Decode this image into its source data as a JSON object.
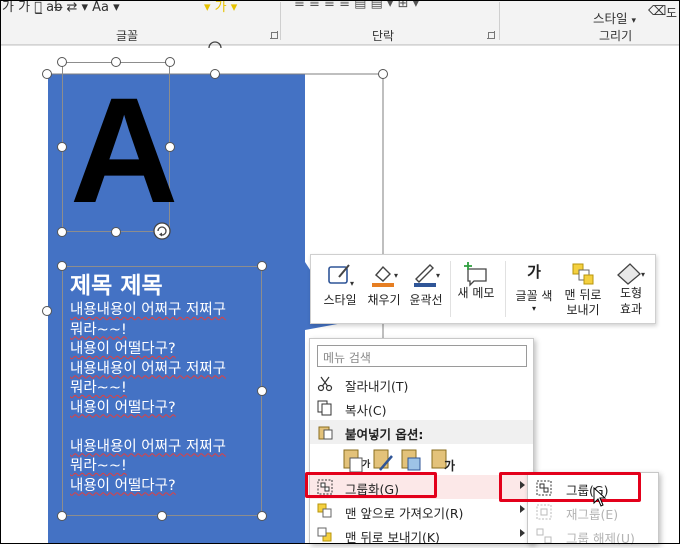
{
  "ribbon": {
    "font_tools": "가 가 가̲ ab̶ ⇄ ▾ Aa ▾",
    "color_tools": "▾  가 ▾",
    "paragraph_tools": "≡ ≡ ≡ ≡ ▤   ▤ ▾  ⊞ ▾",
    "style_label": "스타일",
    "style_arrow": "▾",
    "group_font": "글꼴",
    "group_paragraph": "단락",
    "group_drawing": "그리기",
    "cut_off_char": "도"
  },
  "slide": {
    "big_letter": "A",
    "title": "제목 제목",
    "body_lines": [
      "내용내용이 어쩌구 저쩌구",
      "뭐라~~!",
      "내용이 어떨다구?",
      "내용내용이 어쩌구 저쩌구",
      "뭐라~~!",
      "내용이 어떨다구?",
      "",
      "내용내용이 어쩌구 저쩌구",
      "뭐라~~!",
      "내용이 어떨다구?"
    ],
    "shape_color": "#4472c4"
  },
  "mini_toolbar": {
    "style": "스타일",
    "fill": "채우기",
    "outline": "윤곽선",
    "new_memo": "새 메모",
    "font_color_glyph": "가",
    "font_color": "글꼴 색",
    "send_back_line1": "맨 뒤로",
    "send_back_line2": "보내기",
    "shape_effects_line1": "도형",
    "shape_effects_line2": "효과",
    "accent_fill": "#e67e22",
    "accent_outline": "#2f5597"
  },
  "context_menu": {
    "search_placeholder": "메뉴 검색",
    "cut": "잘라내기(T)",
    "copy": "복사(C)",
    "paste_options": "붙여넣기 옵션:",
    "paste_glyph": "가",
    "group": "그룹화(G)",
    "bring_forward": "맨 앞으로 가져오기(R)",
    "send_backward": "맨 뒤로 보내기(K)"
  },
  "submenu": {
    "group": "그룹(G)",
    "regroup": "재그룹(E)",
    "ungroup": "그룹 해제(U)"
  },
  "highlight_color": "#e3001b"
}
